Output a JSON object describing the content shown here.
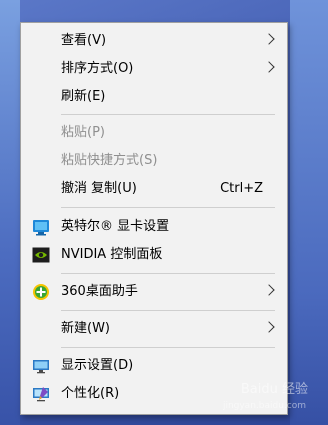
{
  "menu": {
    "view": {
      "label": "查看(V)",
      "icon": "",
      "submenu": true
    },
    "sort": {
      "label": "排序方式(O)",
      "submenu": true
    },
    "refresh": {
      "label": "刷新(E)"
    },
    "paste": {
      "label": "粘贴(P)",
      "disabled": true
    },
    "paste_shortcut": {
      "label": "粘贴快捷方式(S)",
      "disabled": true
    },
    "undo": {
      "label": "撤消 复制(U)",
      "shortcut": "Ctrl+Z"
    },
    "intel": {
      "label": "英特尔® 显卡设置",
      "icon": "intel-graphics-icon"
    },
    "nvidia": {
      "label": "NVIDIA 控制面板",
      "icon": "nvidia-icon"
    },
    "assistant360": {
      "label": "360桌面助手",
      "icon": "360-assistant-icon",
      "submenu": true
    },
    "new": {
      "label": "新建(W)",
      "submenu": true
    },
    "display": {
      "label": "显示设置(D)",
      "icon": "display-settings-icon"
    },
    "personalize": {
      "label": "个性化(R)",
      "icon": "personalize-icon"
    }
  },
  "watermark": {
    "text": "Baidu 经验",
    "sub": "jingyan.baidu.com"
  },
  "colors": {
    "menu_bg": "#f2f2f2",
    "disabled_text": "#8f8f8f",
    "desktop_bg": "#3e58ad"
  }
}
